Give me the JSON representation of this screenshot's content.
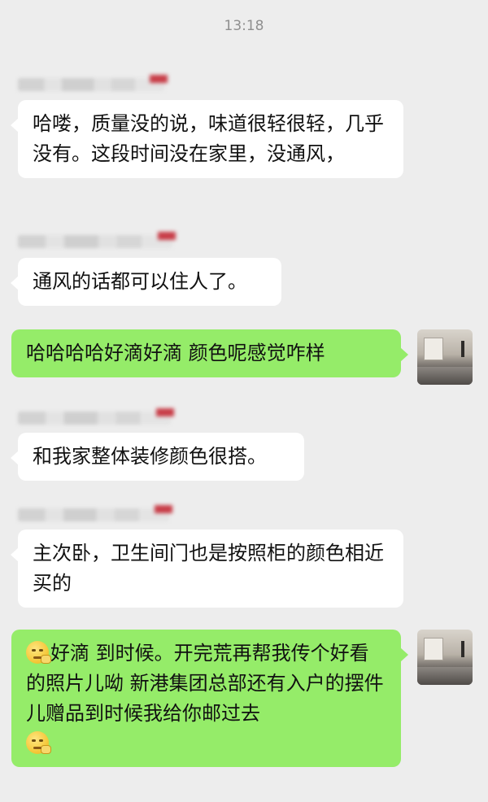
{
  "status": {
    "time": "13:18"
  },
  "messages": [
    {
      "text": "哈喽，质量没的说，味道很轻很轻，几乎没有。这段时间没在家里，没通风，",
      "direction": "in"
    },
    {
      "text": "通风的话都可以住人了。",
      "direction": "in"
    },
    {
      "text": "哈哈哈哈好滴好滴 颜色呢感觉咋样",
      "direction": "out"
    },
    {
      "text": "和我家整体装修颜色很搭。",
      "direction": "in"
    },
    {
      "text": "主次卧，卫生间门也是按照柜的颜色相近买的",
      "direction": "in"
    },
    {
      "text_lead": "好滴 到时候。开完荒再帮我传个好看的照片儿呦 新港集团总部还有入户的摆件儿赠品到时候我给你邮过去",
      "emoji": "thinking-emoji",
      "direction": "out"
    }
  ],
  "colors": {
    "incoming_bubble": "#ffffff",
    "outgoing_bubble": "#95ec69",
    "background": "#ededed"
  }
}
